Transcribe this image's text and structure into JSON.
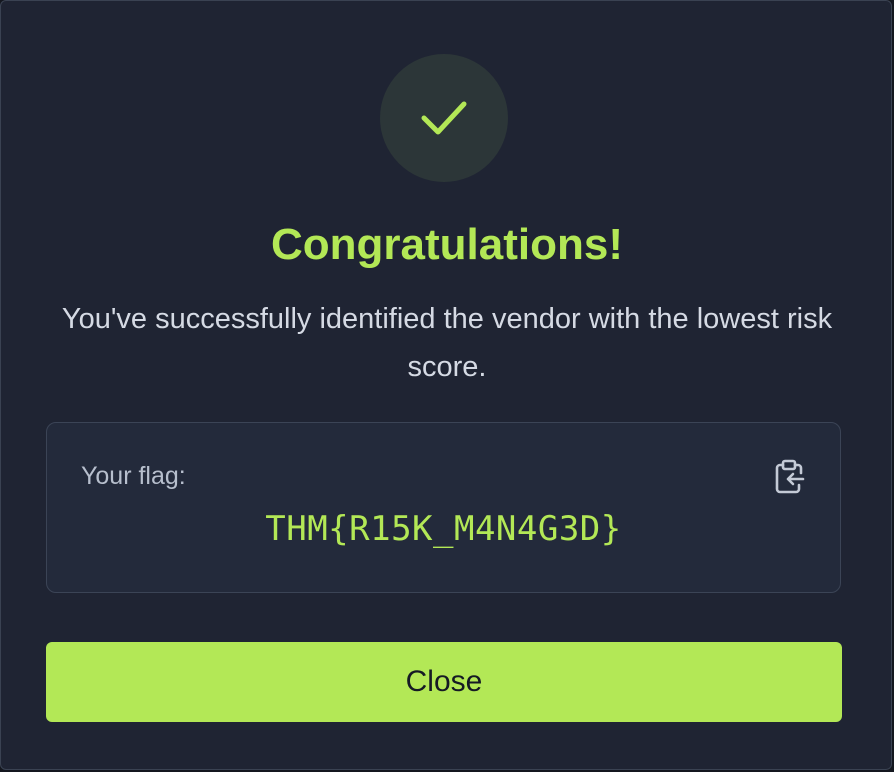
{
  "dialog": {
    "title": "Congratulations!",
    "message": "You've successfully identified the vendor with the lowest risk score.",
    "success_icon": "check-icon",
    "flag": {
      "label": "Your flag:",
      "value": "THM{R15K_M4N4G3D}",
      "copy_icon": "clipboard-copy-icon"
    },
    "close_label": "Close"
  },
  "colors": {
    "background": "#1f2433",
    "accent": "#b3e856",
    "flag_box": "#232a3b",
    "text": "#d5dae4"
  }
}
